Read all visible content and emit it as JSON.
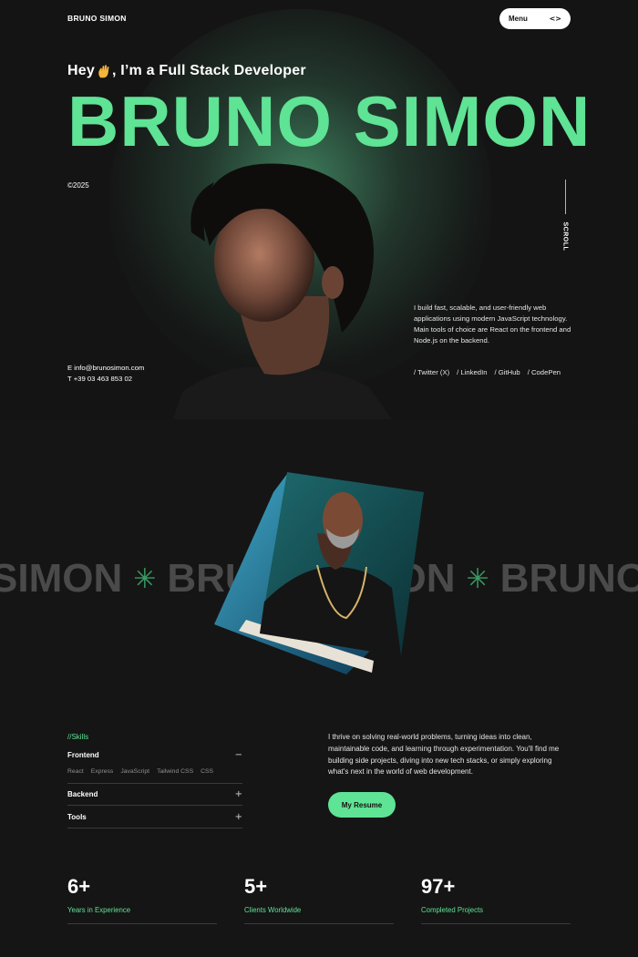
{
  "header": {
    "brand": "BRUNO SIMON",
    "menu_label": "Menu",
    "menu_icon": "code-brackets-icon"
  },
  "hero": {
    "intro_before": "Hey",
    "intro_icon": "waving-hand-icon",
    "intro_after": ", I’m a Full Stack Developer",
    "title": "BRUNO SIMON",
    "year": "©2025",
    "scroll_label": "SCROLL",
    "description": "I build fast, scalable, and user-friendly web applications using modern JavaScript technology. Main tools of choice are React on the frontend and Node.js on the backend.",
    "email_line": "E info@brunosimon.com",
    "phone_line": "T +39 03 463 853 02",
    "socials": [
      "/ Twitter (X)",
      "/ LinkedIn",
      "/ GitHub",
      "/ CodePen"
    ]
  },
  "marquee": {
    "word_1": "SIMON",
    "word_2": "BRU",
    "word_3": "ON",
    "word_4": "BRUNO",
    "separator": "✳"
  },
  "skills": {
    "heading": "//Skills",
    "items": [
      {
        "label": "Frontend",
        "toggle": "−",
        "tags": [
          "React",
          "Express",
          "JavaScript",
          "Tailwind CSS",
          "CSS"
        ]
      },
      {
        "label": "Backend",
        "toggle": "+"
      },
      {
        "label": "Tools",
        "toggle": "+"
      }
    ]
  },
  "about": {
    "text": "I thrive on solving real-world problems, turning ideas into clean, maintainable code, and learning through experimentation.  You'll find me building side projects, diving into new tech stacks, or simply exploring what's next in the world of web development.",
    "resume_label": "My Resume"
  },
  "stats": [
    {
      "value": "6+",
      "label": "Years in Experience"
    },
    {
      "value": "5+",
      "label": "Clients Worldwide"
    },
    {
      "value": "97+",
      "label": "Completed Projects"
    }
  ],
  "colors": {
    "accent": "#5fe394",
    "background": "#151515",
    "marquee_text": "#4a4a4a"
  }
}
